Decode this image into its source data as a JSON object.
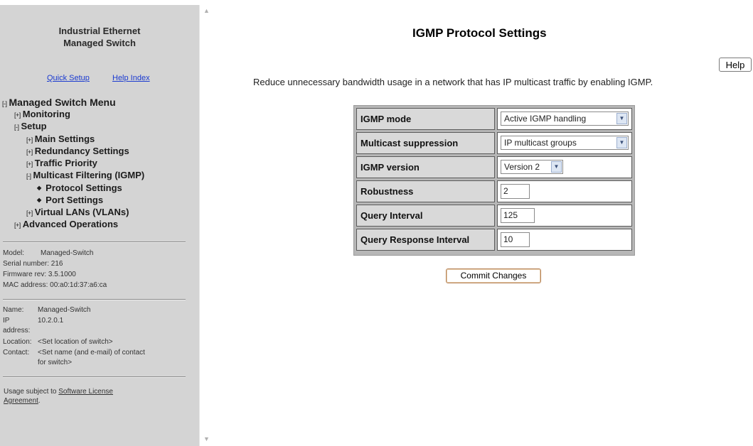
{
  "sidebar": {
    "brand_line1": "Industrial Ethernet",
    "brand_line2": "Managed Switch",
    "quick_setup": "Quick Setup",
    "help_index": "Help Index",
    "menu": {
      "root": {
        "prefix": "[-]",
        "label": "Managed Switch Menu"
      },
      "monitoring": {
        "prefix": "[+]",
        "label": "Monitoring"
      },
      "setup": {
        "prefix": "[-]",
        "label": "Setup"
      },
      "main_settings": {
        "prefix": "[+]",
        "label": "Main Settings"
      },
      "redundancy": {
        "prefix": "[+]",
        "label": "Redundancy Settings"
      },
      "traffic_priority": {
        "prefix": "[+]",
        "label": "Traffic Priority"
      },
      "multicast": {
        "prefix": "[-]",
        "label": "Multicast Filtering (IGMP)"
      },
      "protocol_settings": {
        "bullet": "◆",
        "label": "Protocol Settings"
      },
      "port_settings": {
        "bullet": "◆",
        "label": "Port Settings"
      },
      "vlans": {
        "prefix": "[+]",
        "label": "Virtual LANs (VLANs)"
      },
      "advanced": {
        "prefix": "[+]",
        "label": "Advanced Operations"
      }
    },
    "device": {
      "model_label": "Model:",
      "model": "Managed-Switch",
      "serial": "Serial number: 216",
      "firmware": "Firmware rev: 3.5.1000",
      "mac": "MAC address: 00:a0:1d:37:a6:ca"
    },
    "identity": {
      "name_label": "Name:",
      "name": "Managed-Switch",
      "ip_label_1": "IP",
      "ip_label_2": "address:",
      "ip": "10.2.0.1",
      "location_label": "Location:",
      "location": "<Set location of switch>",
      "contact_label": "Contact:",
      "contact_1": "<Set name (and e-mail) of contact",
      "contact_2": "for switch>"
    },
    "license_prefix": "Usage subject to ",
    "license_link_1": "Software License",
    "license_link_2": "Agreement",
    "license_suffix": "."
  },
  "main": {
    "title": "IGMP Protocol Settings",
    "help_label": "Help",
    "description": "Reduce unnecessary bandwidth usage in a network that has IP multicast traffic by enabling IGMP.",
    "settings": {
      "igmp_mode": {
        "label": "IGMP mode",
        "value": "Active IGMP handling"
      },
      "multicast_suppression": {
        "label": "Multicast suppression",
        "value": "IP multicast groups"
      },
      "igmp_version": {
        "label": "IGMP version",
        "value": "Version 2"
      },
      "robustness": {
        "label": "Robustness",
        "value": "2"
      },
      "query_interval": {
        "label": "Query Interval",
        "value": "125"
      },
      "query_response_interval": {
        "label": "Query Response Interval",
        "value": "10"
      }
    },
    "commit_label": "Commit Changes"
  },
  "icons": {
    "select_arrow": "chevron-down-icon",
    "scroll_up": "scroll-up-icon",
    "scroll_down": "scroll-down-icon"
  },
  "colors": {
    "sidebar_bg": "#d4d4d4",
    "link": "#1a3ad0",
    "table_header_bg": "#d9d9d9"
  }
}
